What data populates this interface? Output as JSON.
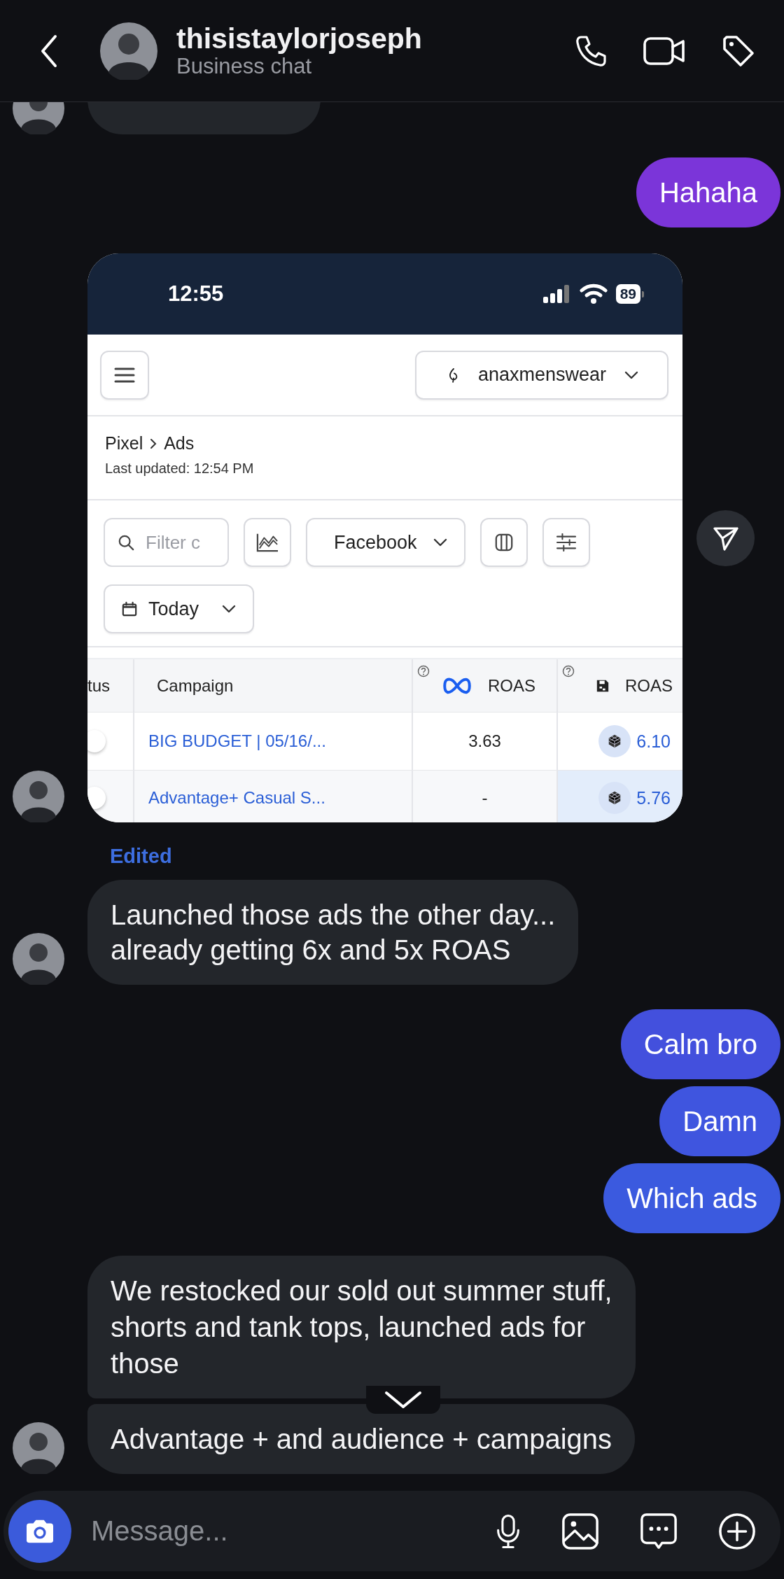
{
  "header": {
    "title": "thisistaylorjoseph",
    "subtitle": "Business chat"
  },
  "messages": [
    {
      "kind": "cut_off",
      "outgoing": false,
      "avatar": true
    },
    {
      "kind": "text",
      "outgoing": true,
      "text": "Hahaha",
      "color": "#7b35d9"
    },
    {
      "kind": "screenshot",
      "outgoing": false,
      "avatar": true,
      "screenshot": {
        "time": "12:55",
        "battery": "89",
        "account": "anaxmenswear",
        "breadcrumb": [
          "Pixel",
          "Ads"
        ],
        "updated": "Last updated: 12:54 PM",
        "filter_placeholder": "Filter c",
        "source": "Facebook",
        "date": "Today",
        "columns": [
          {
            "kind": "status",
            "label": "tus"
          },
          {
            "kind": "campaign",
            "label": "Campaign"
          },
          {
            "kind": "meta",
            "label": "ROAS"
          },
          {
            "kind": "pixel",
            "label": "ROAS"
          }
        ],
        "rows": [
          {
            "campaign": "BIG BUDGET | 05/16/...",
            "meta_roas": "3.63",
            "pixel_roas": "6.10",
            "highlighted": false
          },
          {
            "campaign": "Advantage+ Casual S...",
            "meta_roas": "-",
            "pixel_roas": "5.76",
            "highlighted": true
          }
        ]
      }
    },
    {
      "kind": "text",
      "outgoing": false,
      "avatar": true,
      "note": "Edited",
      "text": "Launched those ads the other day...\nalready getting 6x and 5x ROAS"
    },
    {
      "kind": "text",
      "outgoing": true,
      "text": "Calm bro",
      "color": "#4350dd"
    },
    {
      "kind": "text",
      "outgoing": true,
      "text": "Damn",
      "color": "#3f55df"
    },
    {
      "kind": "text",
      "outgoing": true,
      "text": "Which ads",
      "color": "#3b5adf"
    },
    {
      "kind": "text",
      "outgoing": false,
      "avatar": false,
      "text": "We restocked our sold out summer stuff,\nshorts and tank tops, launched ads for\nthose"
    },
    {
      "kind": "text",
      "outgoing": false,
      "avatar": true,
      "scroll_button": true,
      "text": "Advantage + and audience + campaigns"
    }
  ],
  "composer": {
    "placeholder": "Message..."
  }
}
